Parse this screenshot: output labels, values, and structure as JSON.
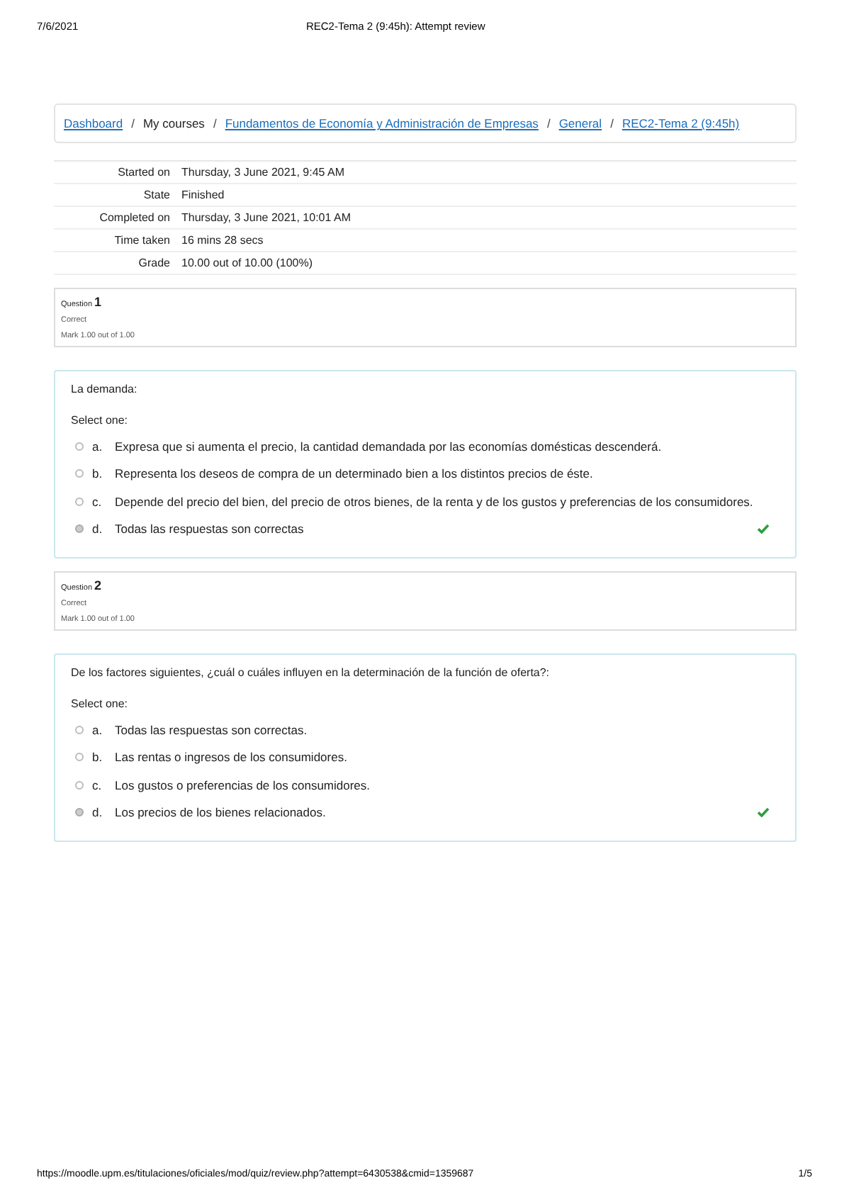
{
  "print_header": {
    "date": "7/6/2021",
    "title": "REC2-Tema 2 (9:45h): Attempt review"
  },
  "breadcrumb": [
    {
      "label": "Dashboard",
      "link": true,
      "separator": "/"
    },
    {
      "label": "My courses",
      "link": false,
      "separator": "/"
    },
    {
      "label": "Fundamentos de Economía y Administración de Empresas",
      "link": true,
      "separator": "/"
    },
    {
      "label": "General",
      "link": true,
      "separator": "/"
    },
    {
      "label": "REC2-Tema 2 (9:45h)",
      "link": true
    }
  ],
  "summary": [
    {
      "label": "Started on",
      "value": "Thursday, 3 June 2021, 9:45 AM"
    },
    {
      "label": "State",
      "value": "Finished"
    },
    {
      "label": "Completed on",
      "value": "Thursday, 3 June 2021, 10:01 AM"
    },
    {
      "label": "Time taken",
      "value": "16 mins 28 secs"
    },
    {
      "label": "Grade",
      "value": "10.00 out of 10.00 (100%)"
    }
  ],
  "questions": [
    {
      "label": "Question",
      "number": "1",
      "status": "Correct",
      "mark": "Mark 1.00 out of 1.00",
      "text": "La demanda:",
      "prompt": "Select one:",
      "options": [
        {
          "letter": "a.",
          "text": "Expresa que si aumenta el precio, la cantidad demandada por las economías domésticas descenderá.",
          "selected": false,
          "correct": false
        },
        {
          "letter": "b.",
          "text": "Representa los deseos de compra de un determinado bien a los distintos precios de éste.",
          "selected": false,
          "correct": false
        },
        {
          "letter": "c.",
          "text": "Depende del precio del bien, del precio de otros bienes, de la renta y de los gustos y preferencias de los consumidores.",
          "selected": false,
          "correct": false
        },
        {
          "letter": "d.",
          "text": "Todas las respuestas son correctas",
          "selected": true,
          "correct": true
        }
      ]
    },
    {
      "label": "Question",
      "number": "2",
      "status": "Correct",
      "mark": "Mark 1.00 out of 1.00",
      "text": "De los factores siguientes, ¿cuál o cuáles influyen en la determinación de la función de oferta?:",
      "prompt": "Select one:",
      "options": [
        {
          "letter": "a.",
          "text": "Todas las respuestas son correctas.",
          "selected": false,
          "correct": false
        },
        {
          "letter": "b.",
          "text": "Las rentas o ingresos de los consumidores.",
          "selected": false,
          "correct": false
        },
        {
          "letter": "c.",
          "text": "Los gustos o preferencias de los consumidores.",
          "selected": false,
          "correct": false
        },
        {
          "letter": "d.",
          "text": "Los precios de los bienes relacionados.",
          "selected": true,
          "correct": true
        }
      ]
    }
  ],
  "print_footer": {
    "url": "https://moodle.upm.es/titulaciones/oficiales/mod/quiz/review.php?attempt=6430538&cmid=1359687",
    "page": "1/5"
  }
}
